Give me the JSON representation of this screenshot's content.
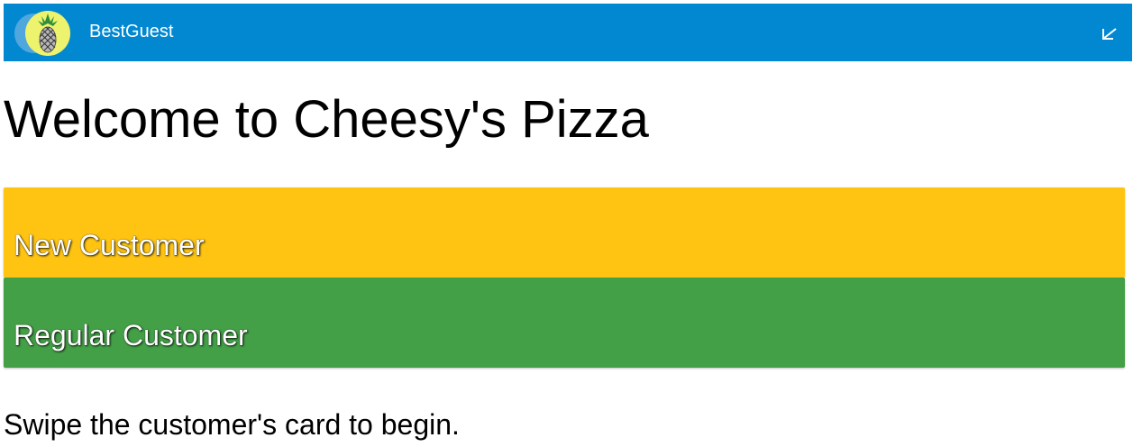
{
  "appbar": {
    "title": "BestGuest",
    "logo_icon": "pineapple-icon",
    "collapse_icon": "collapse-arrow-icon",
    "background_color": "#0288d1"
  },
  "main": {
    "heading": "Welcome to Cheesy's Pizza",
    "buttons": [
      {
        "label": "New Customer",
        "color": "#ffc412"
      },
      {
        "label": "Regular Customer",
        "color": "#43a047"
      }
    ],
    "instructions": "Swipe the customer's card to begin."
  }
}
